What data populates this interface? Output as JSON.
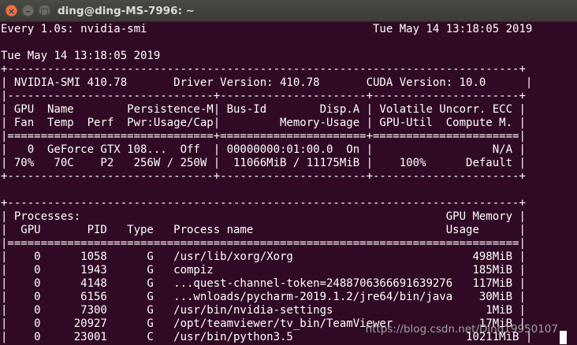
{
  "window": {
    "title": "ding@ding-MS-7996: ~",
    "buttons": [
      "close",
      "minimize",
      "maximize"
    ]
  },
  "terminal": {
    "lines": [
      "Every 1.0s: nvidia-smi                                  Tue May 14 13:18:05 2019",
      "",
      "Tue May 14 13:18:05 2019",
      "+-----------------------------------------------------------------------------+",
      "| NVIDIA-SMI 410.78       Driver Version: 410.78       CUDA Version: 10.0      |",
      "|-------------------------------+----------------------+----------------------+",
      "| GPU  Name        Persistence-M| Bus-Id        Disp.A | Volatile Uncorr. ECC |",
      "| Fan  Temp  Perf  Pwr:Usage/Cap|         Memory-Usage | GPU-Util  Compute M. |",
      "|===============================+======================+======================|",
      "|   0  GeForce GTX 108...  Off  | 00000000:01:00.0  On |                  N/A |",
      "| 70%   70C    P2   256W / 250W |  11066MiB / 11175MiB |    100%      Default |",
      "+-------------------------------+----------------------+----------------------+",
      "",
      "+-----------------------------------------------------------------------------+",
      "| Processes:                                                       GPU Memory |",
      "|  GPU       PID   Type   Process name                             Usage      |",
      "|=============================================================================|",
      "|    0      1058      G   /usr/lib/xorg/Xorg                           498MiB |",
      "|    0      1943      G   compiz                                       185MiB |",
      "|    0      4148      G   ...quest-channel-token=2488706366691639276   117MiB |",
      "|    0      6156      G   ...wnloads/pycharm-2019.1.2/jre64/bin/java    30MiB |",
      "|    0      7300      G   /usr/bin/nvidia-settings                       1MiB |",
      "|    0     20927      G   /opt/teamviewer/tv_bin/TeamViewer             17MiB |",
      "|    0     23001      C   /usr/bin/python3.5                          10211MiB |"
    ]
  },
  "watermark": "https://blog.csdn.net/Ding19950107"
}
